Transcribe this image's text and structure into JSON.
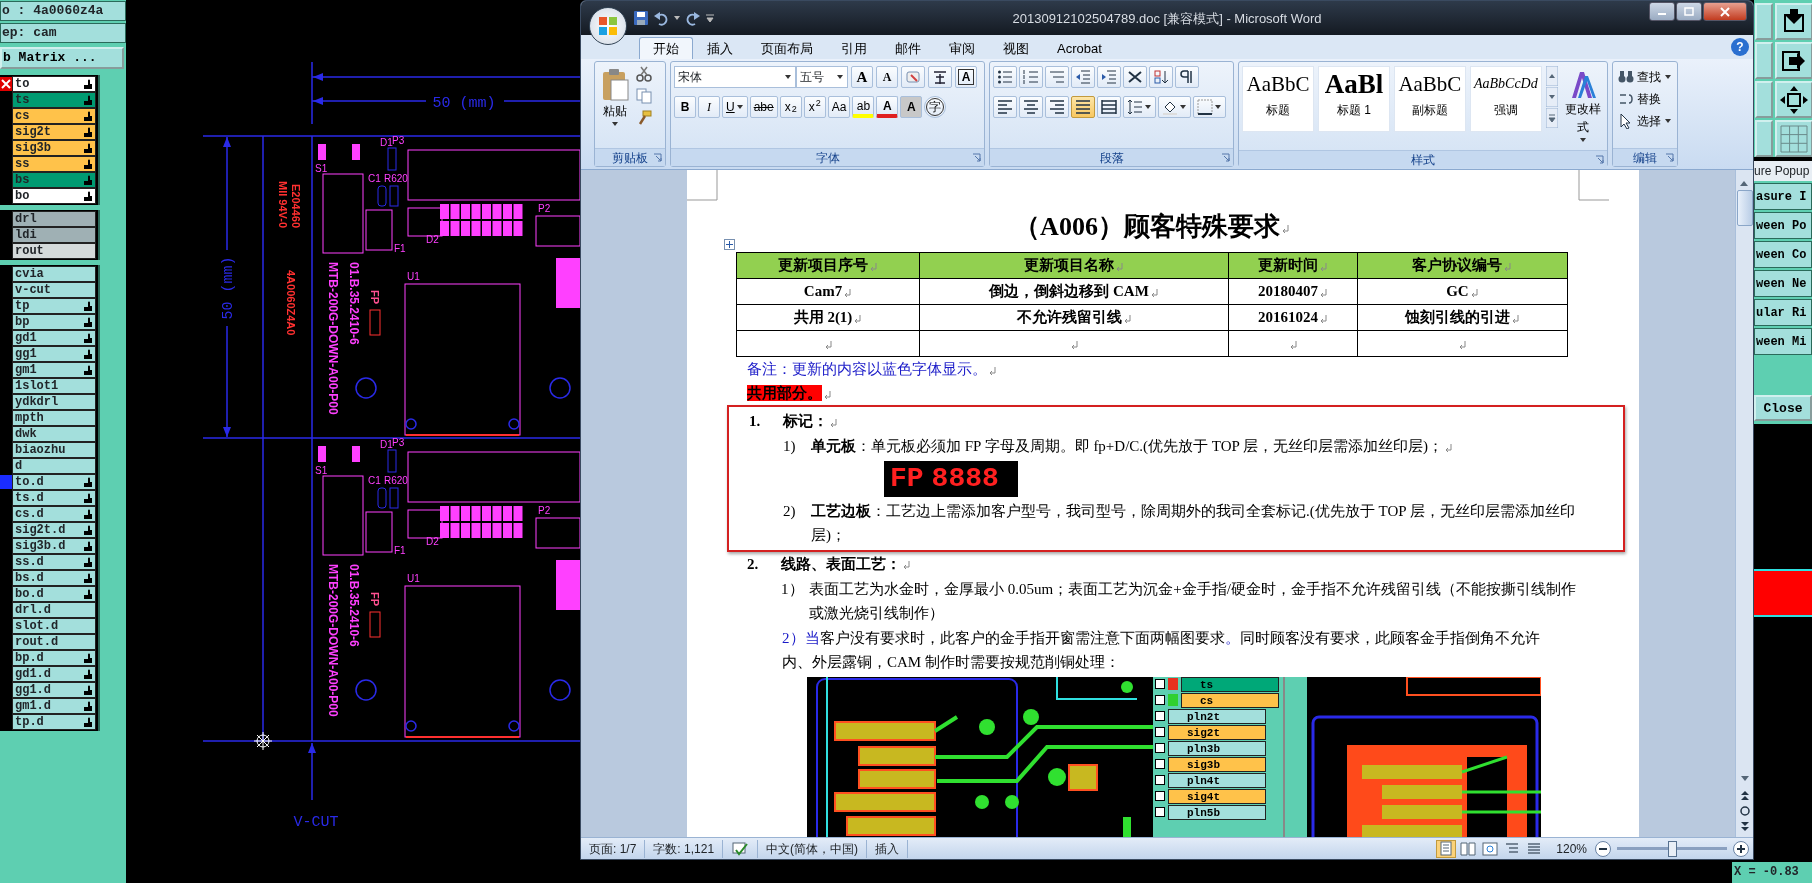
{
  "cam": {
    "job_label": "o : 4a0060z4a",
    "step_label": "ep: cam",
    "matrix_button": "b Matrix ...",
    "layer_groups": [
      [
        {
          "name": "to",
          "color": "#ffffff",
          "hand": true,
          "kind": "flagged"
        },
        {
          "name": "ts",
          "color": "#009b72",
          "hand": true,
          "kind": "plain"
        },
        {
          "name": "cs",
          "color": "#ffc24a",
          "hand": true,
          "kind": "plain"
        },
        {
          "name": "sig2t",
          "color": "#ffc24a",
          "hand": true,
          "kind": "plain"
        },
        {
          "name": "sig3b",
          "color": "#ffc24a",
          "hand": true,
          "kind": "plain"
        },
        {
          "name": "ss",
          "color": "#ffc24a",
          "hand": true,
          "kind": "plain"
        },
        {
          "name": "bs",
          "color": "#009b72",
          "hand": true,
          "kind": "plain"
        },
        {
          "name": "bo",
          "color": "#ffffff",
          "hand": true,
          "kind": "plain"
        }
      ],
      [
        {
          "name": "drl",
          "color": "#9fb0b4",
          "hand": false,
          "kind": "plain"
        },
        {
          "name": "ldi",
          "color": "#9fb0b4",
          "hand": false,
          "kind": "plain"
        },
        {
          "name": "rout",
          "color": "#d4dada",
          "hand": false,
          "kind": "plain"
        }
      ],
      [
        {
          "name": "cvia",
          "color": "#a3dfdc",
          "hand": false,
          "kind": "plain"
        },
        {
          "name": "v-cut",
          "color": "#a3dfdc",
          "hand": false,
          "kind": "plain"
        },
        {
          "name": "tp",
          "color": "#a3dfdc",
          "hand": true,
          "kind": "plain"
        },
        {
          "name": "bp",
          "color": "#a3dfdc",
          "hand": true,
          "kind": "plain"
        },
        {
          "name": "gd1",
          "color": "#a3dfdc",
          "hand": true,
          "kind": "plain"
        },
        {
          "name": "gg1",
          "color": "#a3dfdc",
          "hand": true,
          "kind": "plain"
        },
        {
          "name": "gm1",
          "color": "#a3dfdc",
          "hand": true,
          "kind": "plain"
        },
        {
          "name": "1slot1",
          "color": "#a3dfdc",
          "hand": false,
          "kind": "plain"
        },
        {
          "name": "ydkdrl",
          "color": "#a3dfdc",
          "hand": false,
          "kind": "plain"
        },
        {
          "name": "mpth",
          "color": "#a3dfdc",
          "hand": false,
          "kind": "plain"
        },
        {
          "name": "dwk",
          "color": "#a3dfdc",
          "hand": false,
          "kind": "plain"
        },
        {
          "name": "biaozhu",
          "color": "#a3dfdc",
          "hand": false,
          "kind": "plain"
        },
        {
          "name": "d",
          "color": "#a3dfdc",
          "hand": false,
          "kind": "plain"
        },
        {
          "name": "to.d",
          "color": "#a3dfdc",
          "hand": true,
          "kind": "current"
        },
        {
          "name": "ts.d",
          "color": "#a3dfdc",
          "hand": true,
          "kind": "plain"
        },
        {
          "name": "cs.d",
          "color": "#a3dfdc",
          "hand": true,
          "kind": "plain"
        },
        {
          "name": "sig2t.d",
          "color": "#a3dfdc",
          "hand": true,
          "kind": "plain"
        },
        {
          "name": "sig3b.d",
          "color": "#a3dfdc",
          "hand": true,
          "kind": "plain"
        },
        {
          "name": "ss.d",
          "color": "#a3dfdc",
          "hand": true,
          "kind": "plain"
        },
        {
          "name": "bs.d",
          "color": "#a3dfdc",
          "hand": true,
          "kind": "plain"
        },
        {
          "name": "bo.d",
          "color": "#a3dfdc",
          "hand": true,
          "kind": "plain"
        },
        {
          "name": "drl.d",
          "color": "#a3dfdc",
          "hand": false,
          "kind": "plain"
        },
        {
          "name": "slot.d",
          "color": "#a3dfdc",
          "hand": false,
          "kind": "plain"
        },
        {
          "name": "rout.d",
          "color": "#a3dfdc",
          "hand": false,
          "kind": "plain"
        },
        {
          "name": "bp.d",
          "color": "#a3dfdc",
          "hand": true,
          "kind": "plain"
        },
        {
          "name": "gd1.d",
          "color": "#a3dfdc",
          "hand": true,
          "kind": "plain"
        },
        {
          "name": "gg1.d",
          "color": "#a3dfdc",
          "hand": true,
          "kind": "plain"
        },
        {
          "name": "gm1.d",
          "color": "#a3dfdc",
          "hand": true,
          "kind": "plain"
        },
        {
          "name": "tp.d",
          "color": "#a3dfdc",
          "hand": true,
          "kind": "plain"
        }
      ]
    ],
    "canvas": {
      "dim_horizontal": "50 (mm)",
      "dim_vertical": "50 (mm)",
      "vcut": "V-CUT",
      "margin_labels": [
        "E204460",
        "MII 94V-0",
        "4A0060Z4A0"
      ],
      "boards": [
        {
          "part_number": "01.B.35.2410-6",
          "model": "MTB-200G-DOWN-A00-P00",
          "fp": "FP",
          "refs": [
            "S1",
            "D1",
            "P3",
            "C1",
            "R620",
            "F1",
            "D2",
            "P2",
            "U1"
          ]
        },
        {
          "part_number": "01.B.35.2410-6",
          "model": "MTB-200G-DOWN-A00-P00",
          "fp": "FP",
          "refs": [
            "S1",
            "D1",
            "P3",
            "C1",
            "R620",
            "F1",
            "D2",
            "P2",
            "U1"
          ]
        }
      ]
    },
    "popup": {
      "title": "ure Popup",
      "items": [
        "asure I",
        "ween Po",
        "ween Co",
        "ween Ne",
        "ular Ri",
        "ween Mi"
      ],
      "close": "Close"
    },
    "coord_x": "X = -0.83"
  },
  "word": {
    "title": "20130912102504789.doc [兼容模式] - Microsoft Word",
    "tabs": [
      {
        "label": "开始",
        "selected": true
      },
      {
        "label": "插入",
        "selected": false
      },
      {
        "label": "页面布局",
        "selected": false
      },
      {
        "label": "引用",
        "selected": false
      },
      {
        "label": "邮件",
        "selected": false
      },
      {
        "label": "审阅",
        "selected": false
      },
      {
        "label": "视图",
        "selected": false
      },
      {
        "label": "Acrobat",
        "selected": false
      }
    ],
    "help": "?",
    "ribbon": {
      "clipboard": {
        "label": "剪贴板",
        "paste": "粘贴"
      },
      "font": {
        "label": "字体",
        "font": "宋体",
        "size": "五号",
        "row1": [
          {
            "kind": "grow",
            "label": "A"
          },
          {
            "kind": "shrink",
            "label": "A"
          },
          {
            "kind": "clear"
          },
          {
            "kind": "phonetic"
          },
          {
            "kind": "border",
            "label": "A"
          }
        ],
        "row2": [
          {
            "kind": "bold",
            "label": "B"
          },
          {
            "kind": "italic",
            "label": "I"
          },
          {
            "kind": "underline",
            "label": "U"
          },
          {
            "kind": "strike",
            "label": "abe"
          },
          {
            "kind": "sub",
            "label": "x$_{2}$"
          },
          {
            "kind": "sup",
            "label": "x$^{2}$"
          },
          {
            "kind": "case",
            "label": "Aa"
          },
          {
            "kind": "highlight",
            "label": "ab"
          },
          {
            "kind": "color",
            "label": "A"
          },
          {
            "kind": "shade",
            "label": "A"
          },
          {
            "kind": "enclose",
            "label": "字"
          }
        ]
      },
      "paragraph": {
        "label": "段落",
        "alignments": [
          {
            "kind": "left",
            "selected": false
          },
          {
            "kind": "center",
            "selected": false
          },
          {
            "kind": "right",
            "selected": false
          },
          {
            "kind": "justify",
            "selected": true
          },
          {
            "kind": "distributed",
            "selected": false
          }
        ]
      },
      "styles": {
        "label": "样式",
        "items": [
          {
            "sample": "AaBbC",
            "label": "标题",
            "kind": "serif"
          },
          {
            "sample": "AaBl",
            "label": "标题 1",
            "kind": "large"
          },
          {
            "sample": "AaBbC",
            "label": "副标题",
            "kind": "serif"
          },
          {
            "sample": "AaBbCcDd",
            "label": "强调",
            "kind": "italic"
          }
        ],
        "change": "更改样式"
      },
      "editing": {
        "label": "编辑",
        "items": [
          "查找",
          "替换",
          "选择"
        ]
      }
    },
    "document": {
      "title": "（A006）顾客特殊要求",
      "table": {
        "columns": [
          "更新项目序号",
          "更新项目名称",
          "更新时间",
          "客户协议编号"
        ],
        "rows": [
          {
            "blank": false,
            "cells": [
              "Cam7",
              "倒边，倒斜边移到 CAM",
              "20180407",
              "GC"
            ]
          },
          {
            "blank": false,
            "cells": [
              "共用 2(1)",
              "不允许残留引线",
              "20161024",
              "蚀刻引线的引进"
            ]
          },
          {
            "blank": true
          }
        ]
      },
      "note": "备注：更新的内容以蓝色字体显示。",
      "section_label": "共用部分。",
      "sections": [
        {
          "number": "1.",
          "heading": "标记：",
          "framed": true,
          "items": [
            {
              "kind": "plain",
              "number": "1)",
              "text": "**单元板**：单元板必须加 FP 字母及周期。即 fp+D/C.(优先放于 TOP 层，无丝印层需添加丝印层)；",
              "display": {
                "prefix": "FP",
                "digits": "8888"
              }
            },
            {
              "kind": "plain",
              "number": "2)",
              "text": "**工艺边板**：工艺边上需添加客户型号，我司型号，除周期外的我司全套标记.(优先放于 TOP 层，无丝印层需添加丝印层)；"
            }
          ]
        },
        {
          "number": "2.",
          "heading": "线路、表面工艺：",
          "framed": false,
          "items": [
            {
              "kind": "plain",
              "number": "1）",
              "text": "表面工艺为水金时，金厚最小 0.05um；表面工艺为沉金+金手指/硬金时，金手指不允许残留引线（不能按撕引线制作或激光烧引线制作）"
            },
            {
              "kind": "segmented",
              "segments": [
                {
                  "text": "2）当",
                  "updated": true
                },
                {
                  "text": "客户没有要求时，此客户的金手指开窗需注意下面两幅图要求",
                  "updated": false
                },
                {
                  "text": "。",
                  "updated": true
                },
                {
                  "text": "同时顾客没有要求，此顾客金手指倒角不允许内、外层露铜，CAM 制作时需要按规范削铜处理：",
                  "updated": false
                }
              ],
              "figure": {
                "layers": [
                  {
                    "name": "ts",
                    "color": "#00a878",
                    "swatch": {
                      "color": "#e83020"
                    }
                  },
                  {
                    "name": "cs",
                    "color": "#ffc24a",
                    "swatch": {
                      "color": "#30d030"
                    }
                  },
                  {
                    "name": "pln2t",
                    "color": "#a3dfdc"
                  },
                  {
                    "name": "sig2t",
                    "color": "#ffc24a"
                  },
                  {
                    "name": "pln3b",
                    "color": "#a3dfdc"
                  },
                  {
                    "name": "sig3b",
                    "color": "#ffc24a"
                  },
                  {
                    "name": "pln4t",
                    "color": "#a3dfdc"
                  },
                  {
                    "name": "sig4t",
                    "color": "#ffc24a"
                  },
                  {
                    "name": "pln5b",
                    "color": "#a3dfdc"
                  }
                ]
              }
            }
          ]
        }
      ]
    },
    "status_bar": {
      "page": "页面: 1/7",
      "words": "字数: 1,121",
      "language": "中文(简体，中国)",
      "mode": "插入",
      "views": [
        {
          "kind": "print",
          "selected": true
        },
        {
          "kind": "read",
          "selected": false
        },
        {
          "kind": "web",
          "selected": false
        },
        {
          "kind": "outline",
          "selected": false
        },
        {
          "kind": "draft",
          "selected": false
        }
      ],
      "zoom": "120%",
      "zoom_slider": {
        "level": 0.5
      }
    }
  }
}
